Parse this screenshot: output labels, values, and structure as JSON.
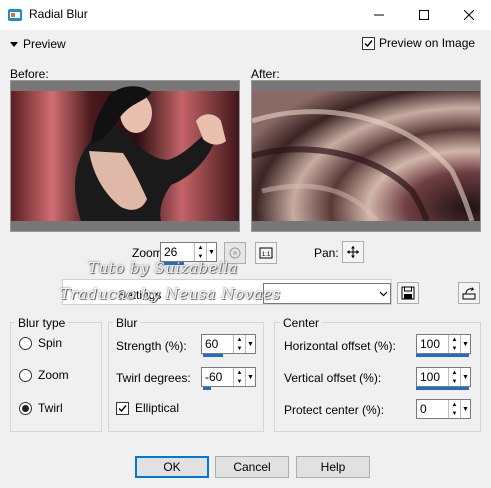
{
  "window": {
    "title": "Radial Blur"
  },
  "preview": {
    "toggle_label": "Preview",
    "preview_on_image_label": "Preview on Image",
    "preview_on_image_checked": true
  },
  "panes": {
    "before_label": "Before:",
    "after_label": "After:"
  },
  "zoom": {
    "label": "Zoom:",
    "value": "26",
    "pan_label": "Pan:"
  },
  "watermark": {
    "line1": "Tuto by  Suizabella",
    "line2": "Traducao by  Neusa Novaes"
  },
  "settings": {
    "label": "Settings",
    "value": ""
  },
  "blur_type": {
    "title": "Blur type",
    "options": [
      "Spin",
      "Zoom",
      "Twirl"
    ],
    "selected": "Twirl"
  },
  "blur": {
    "title": "Blur",
    "strength_label": "Strength (%):",
    "strength_value": "60",
    "twirl_label": "Twirl degrees:",
    "twirl_value": "-60",
    "elliptical_label": "Elliptical",
    "elliptical_checked": true
  },
  "center": {
    "title": "Center",
    "h_label": "Horizontal offset (%):",
    "h_value": "100",
    "v_label": "Vertical offset (%):",
    "v_value": "100",
    "protect_label": "Protect center (%):",
    "protect_value": "0"
  },
  "buttons": {
    "ok": "OK",
    "cancel": "Cancel",
    "help": "Help"
  },
  "colors": {
    "accent": "#1e6ec8",
    "default_border": "#0078d7"
  },
  "icons": [
    "app-icon",
    "minimize-icon",
    "maximize-icon",
    "close-icon",
    "eye-icon",
    "fit-icon",
    "pan-move-icon",
    "save-icon",
    "preset-open-icon"
  ]
}
